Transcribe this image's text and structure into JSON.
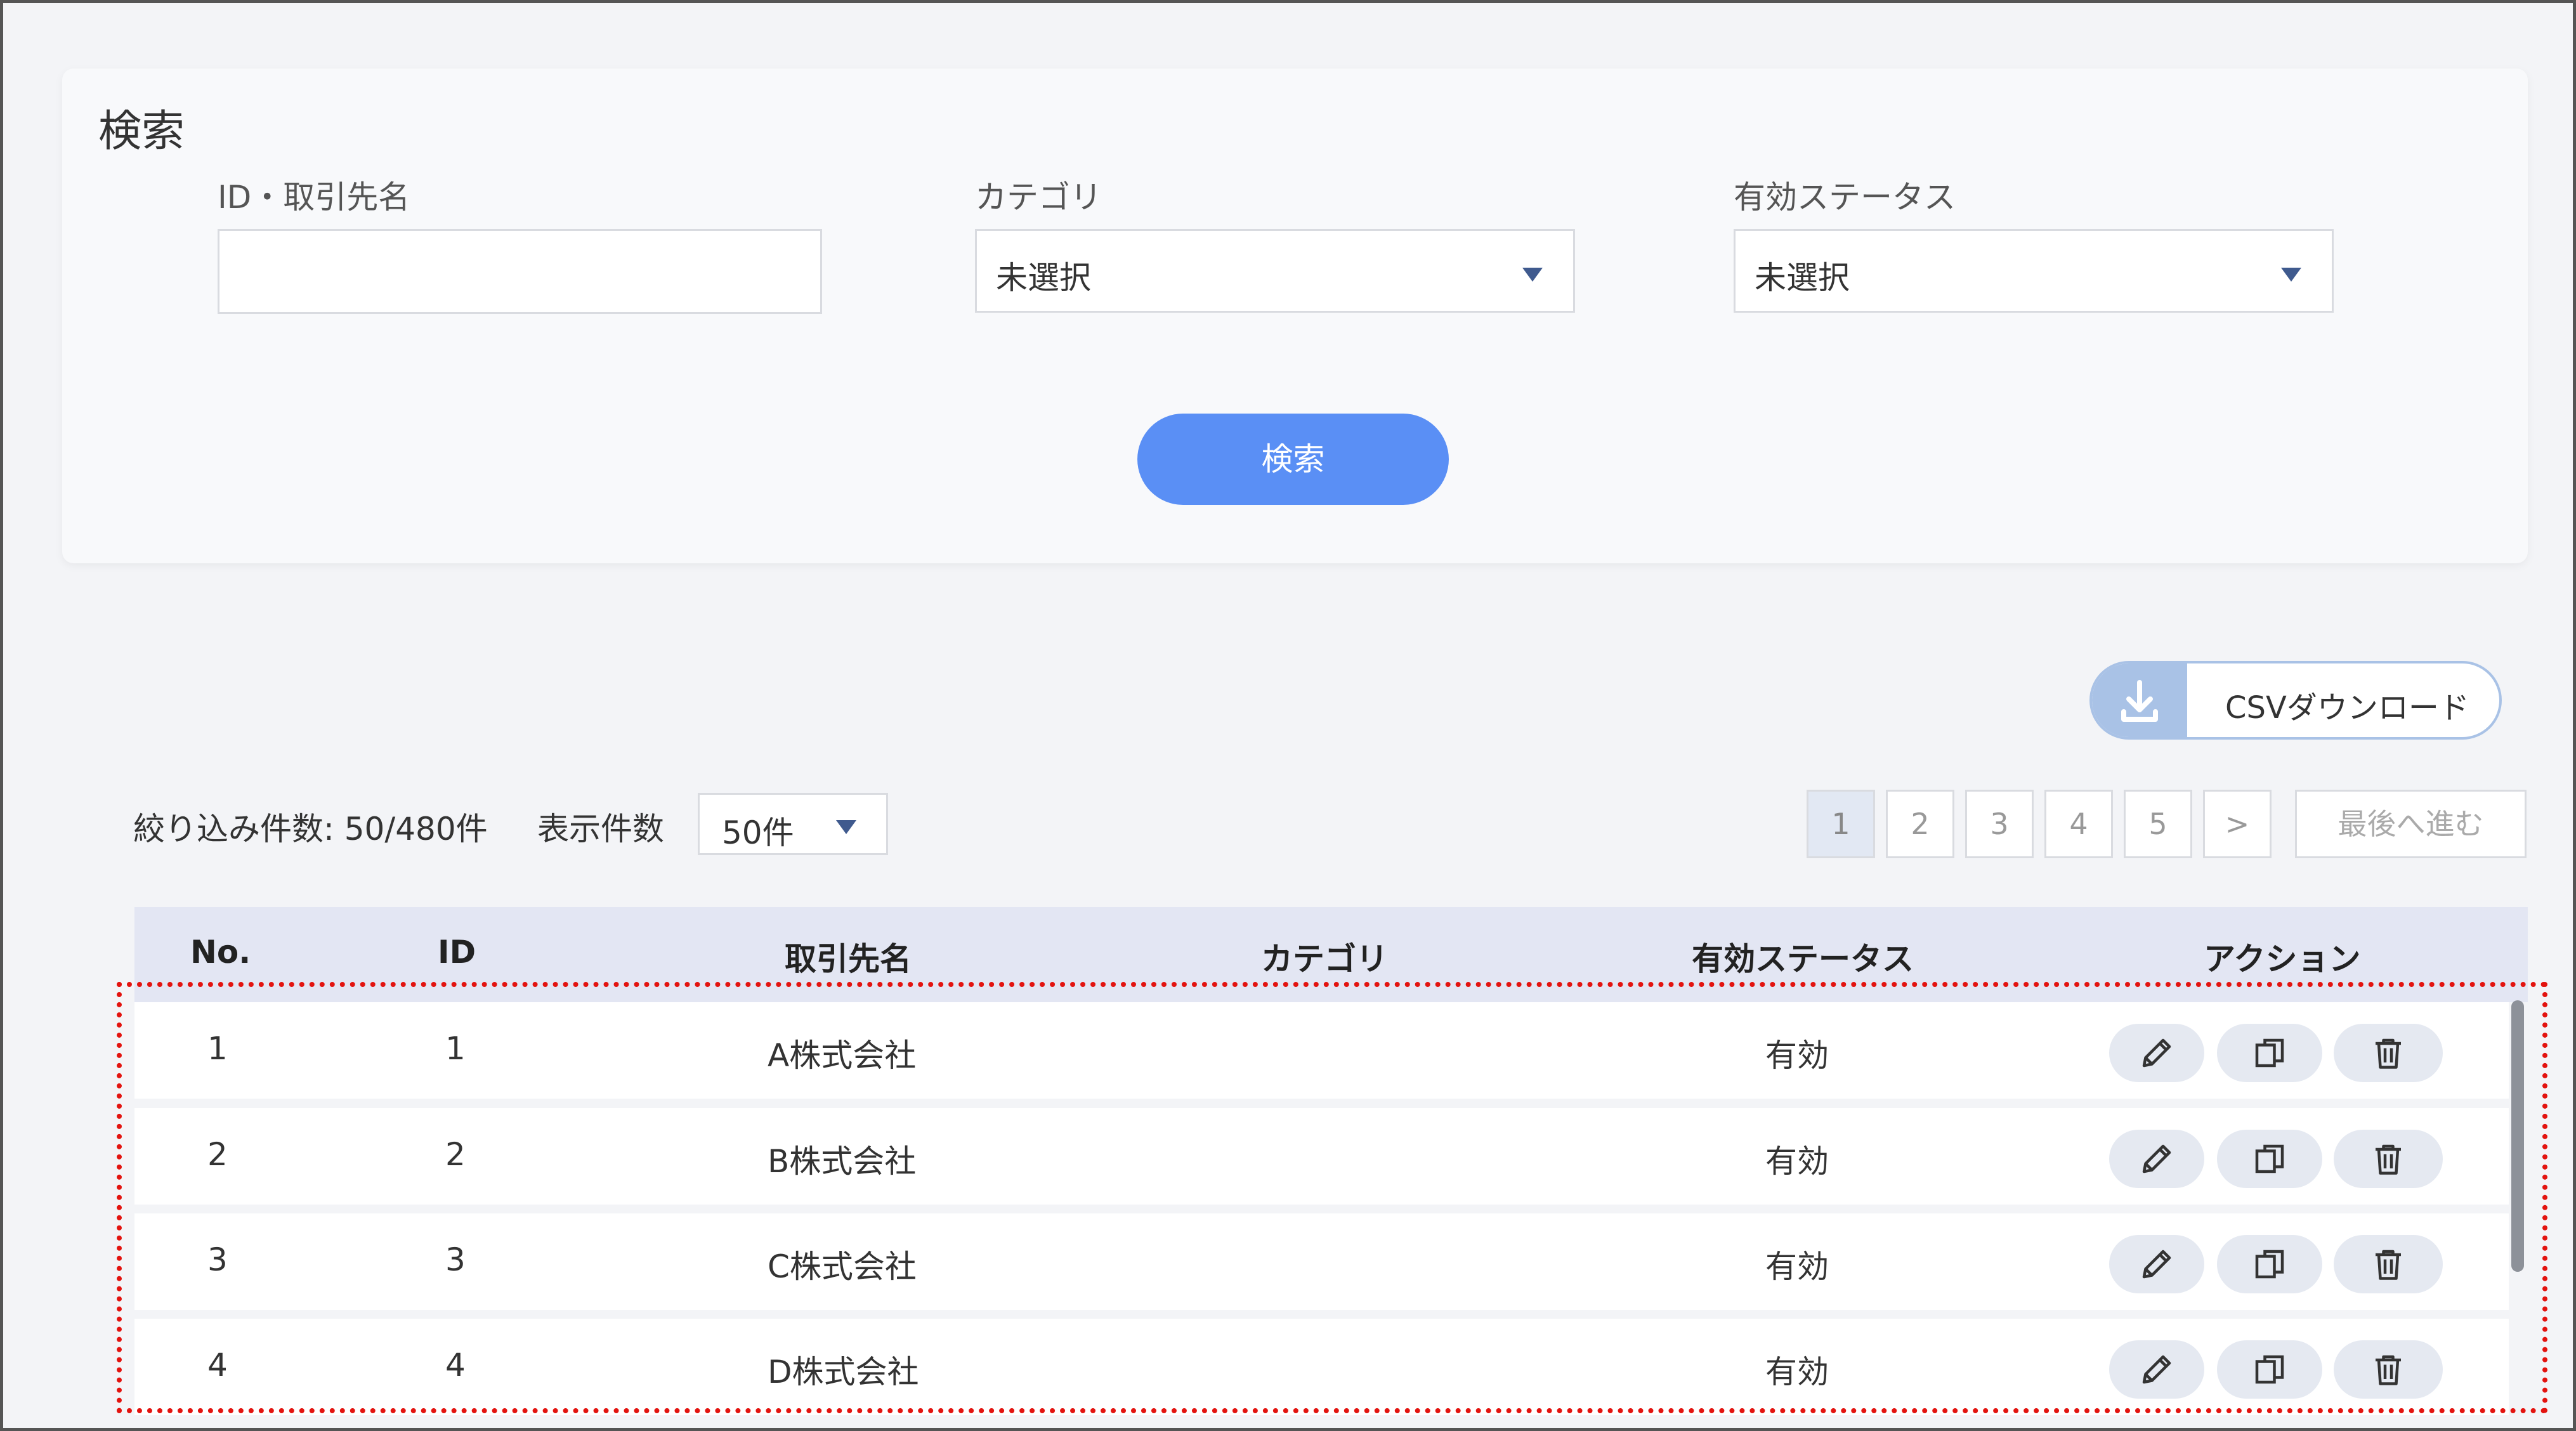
{
  "search": {
    "title": "検索",
    "fields": {
      "id_name": {
        "label": "ID・取引先名",
        "value": ""
      },
      "category": {
        "label": "カテゴリ",
        "value": "未選択"
      },
      "status": {
        "label": "有効ステータス",
        "value": "未選択"
      }
    },
    "button_label": "検索"
  },
  "csv_button": {
    "label": "CSVダウンロード",
    "icon": "download-icon"
  },
  "result_count": "絞り込み件数: 50/480件",
  "per_page": {
    "label": "表示件数",
    "value": "50件"
  },
  "pagination": {
    "pages": [
      "1",
      "2",
      "3",
      "4",
      "5",
      ">"
    ],
    "current": "1",
    "last_label": "最後へ進む"
  },
  "table": {
    "headers": [
      "No.",
      "ID",
      "取引先名",
      "カテゴリ",
      "有効ステータス",
      "アクション"
    ],
    "rows": [
      {
        "no": "1",
        "id": "1",
        "name": "A株式会社",
        "category": "",
        "status": "有効"
      },
      {
        "no": "2",
        "id": "2",
        "name": "B株式会社",
        "category": "",
        "status": "有効"
      },
      {
        "no": "3",
        "id": "3",
        "name": "C株式会社",
        "category": "",
        "status": "有効"
      },
      {
        "no": "4",
        "id": "4",
        "name": "D株式会社",
        "category": "",
        "status": "有効"
      }
    ],
    "action_icons": [
      "pencil-icon",
      "copy-icon",
      "trash-icon"
    ]
  },
  "colors": {
    "accent": "#5a8ff5",
    "highlight_border": "#e3130f",
    "header_bg": "#e3e6f3"
  }
}
